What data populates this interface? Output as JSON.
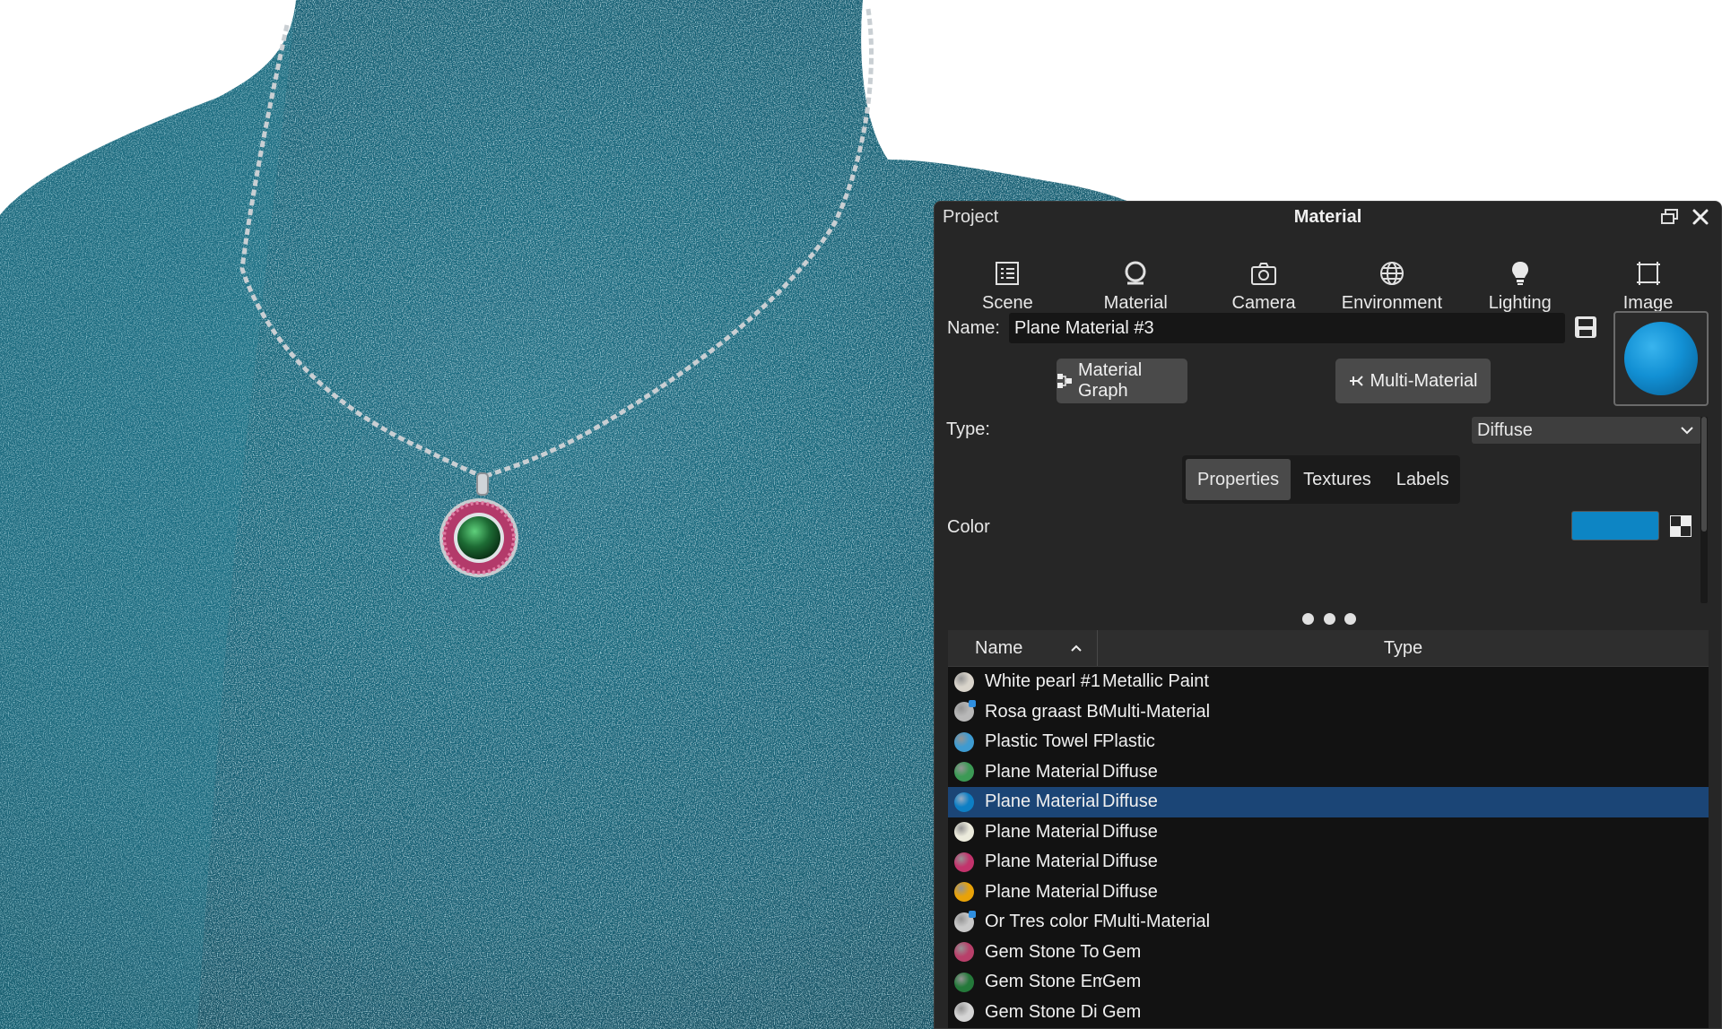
{
  "panel": {
    "project_label": "Project",
    "title": "Material"
  },
  "tabs": [
    {
      "label": "Scene",
      "icon": "list-icon"
    },
    {
      "label": "Material",
      "icon": "material-icon",
      "active": true
    },
    {
      "label": "Camera",
      "icon": "camera-icon"
    },
    {
      "label": "Environment",
      "icon": "globe-icon"
    },
    {
      "label": "Lighting",
      "icon": "bulb-icon"
    },
    {
      "label": "Image",
      "icon": "image-frame-icon"
    }
  ],
  "material": {
    "name_label": "Name:",
    "name_value": "Plane Material #3",
    "preview_color": "#1290d4",
    "graph_button": "Material Graph",
    "multi_button": "Multi-Material",
    "type_label": "Type:",
    "type_value": "Diffuse",
    "subtabs": [
      "Properties",
      "Textures",
      "Labels"
    ],
    "active_subtab": "Properties",
    "color_label": "Color",
    "color_value": "#0d85c4"
  },
  "list": {
    "columns": {
      "name": "Name",
      "type": "Type"
    },
    "sort": "ascending",
    "rows": [
      {
        "name": "White pearl #1",
        "type": "Metallic Paint",
        "color": "#d9d4cb"
      },
      {
        "name": "Rosa graast BC",
        "type": "Multi-Material",
        "color": "#b8b8b8",
        "multi": true
      },
      {
        "name": "Plastic Towel F",
        "type": "Plastic",
        "color": "#3e9bd1"
      },
      {
        "name": "Plane Material",
        "type": "Diffuse",
        "color": "#3c9a55"
      },
      {
        "name": "Plane Material",
        "type": "Diffuse",
        "color": "#0d7fc4",
        "selected": true
      },
      {
        "name": "Plane Material",
        "type": "Diffuse",
        "color": "#ecebdc"
      },
      {
        "name": "Plane Material",
        "type": "Diffuse",
        "color": "#c2336c"
      },
      {
        "name": "Plane Material",
        "type": "Diffuse",
        "color": "#e8a208"
      },
      {
        "name": "Or Tres color F",
        "type": "Multi-Material",
        "color": "#c8c8c8",
        "multi": true
      },
      {
        "name": "Gem Stone To",
        "type": "Gem",
        "color": "#b8406a"
      },
      {
        "name": "Gem Stone Em",
        "type": "Gem",
        "color": "#24793a"
      },
      {
        "name": "Gem Stone Di",
        "type": "Gem",
        "color": "#d5d5d5"
      }
    ]
  }
}
